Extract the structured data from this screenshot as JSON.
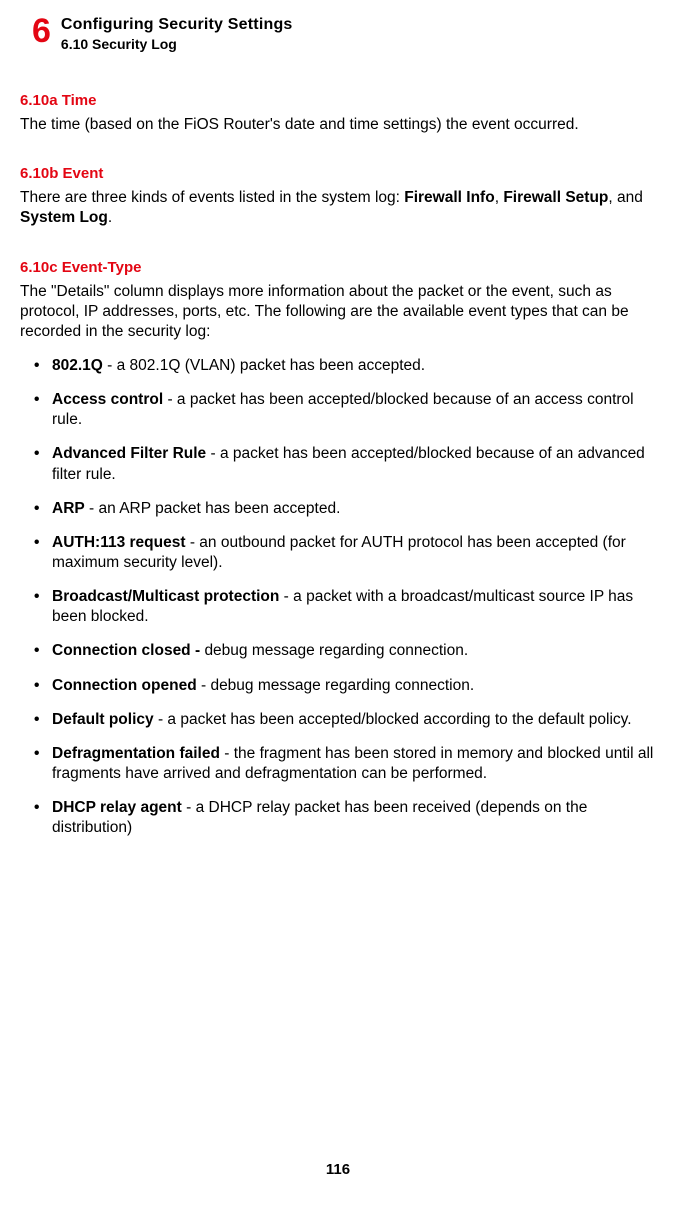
{
  "header": {
    "chapter_number": "6",
    "chapter_title": "Configuring Security Settings",
    "section_title": "6.10  Security Log"
  },
  "subsections": [
    {
      "heading": "6.10a  Time",
      "body": "The time (based on the FiOS Router's date and time settings) the event occurred."
    },
    {
      "heading": "6.10b  Event",
      "body_pre": "There are three kinds of events listed in the system log: ",
      "bold1": "Firewall Info",
      "mid1": ", ",
      "bold2": "Firewall Setup",
      "mid2": ", and ",
      "bold3": "System Log",
      "body_post": "."
    },
    {
      "heading": "6.10c  Event-Type",
      "body": "The \"Details\" column displays more information about the packet or the event, such as protocol, IP addresses, ports, etc. The following are the available event types that can be recorded in the security log:"
    }
  ],
  "bullets": [
    {
      "term": "802.1Q",
      "desc": " - a 802.1Q (VLAN) packet has been accepted."
    },
    {
      "term": "Access control",
      "desc": " - a packet has been accepted/blocked because of an access control rule."
    },
    {
      "term": "Advanced Filter Rule",
      "desc": " - a packet has been accepted/blocked because of an advanced filter rule."
    },
    {
      "term": "ARP",
      "desc": " - an ARP packet has been accepted."
    },
    {
      "term": "AUTH:113 request",
      "desc": " - an outbound packet for AUTH protocol has been accepted (for maximum security level)."
    },
    {
      "term": "Broadcast/Multicast protection",
      "desc": " - a packet with a broadcast/multicast source IP has been blocked."
    },
    {
      "term": "Connection closed - ",
      "desc": "debug message regarding connection."
    },
    {
      "term": "Connection opened",
      "desc": " - debug message regarding connection."
    },
    {
      "term": "Default policy",
      "desc": " - a packet has been accepted/blocked according to the default policy."
    },
    {
      "term": "Defragmentation failed",
      "desc": " - the fragment has been stored in memory and blocked until all fragments have arrived and defragmentation can be performed."
    },
    {
      "term": "DHCP relay agent",
      "desc": " - a DHCP relay packet has been received (depends on the distribution)"
    }
  ],
  "page_number": "116"
}
